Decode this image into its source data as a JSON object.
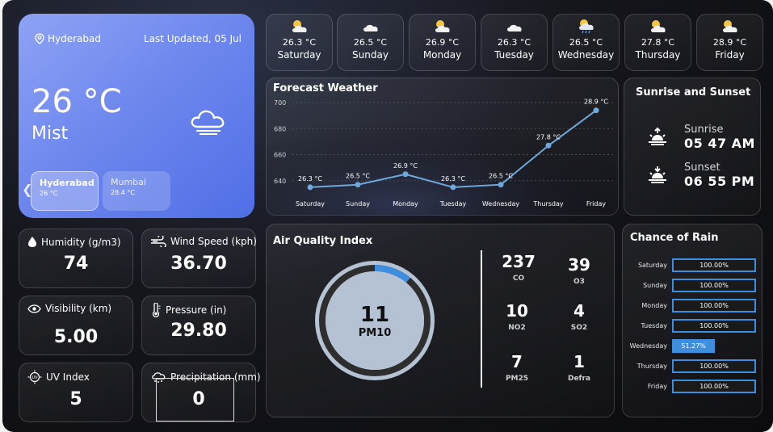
{
  "current": {
    "location": "Hyderabad",
    "last_updated": "Last Updated, 05 Jul",
    "temperature": "26 °C",
    "condition": "Mist",
    "cities": [
      {
        "name": "Hyderabad",
        "temp": "26 °C"
      },
      {
        "name": "Mumbai",
        "temp": "28.4 °C"
      }
    ]
  },
  "daily": [
    {
      "temp": "26.3 °C",
      "day": "Saturday",
      "icon": "sun-cloud-icon"
    },
    {
      "temp": "26.5 °C",
      "day": "Sunday",
      "icon": "cloud-icon"
    },
    {
      "temp": "26.9 °C",
      "day": "Monday",
      "icon": "sun-cloud-icon"
    },
    {
      "temp": "26.3 °C",
      "day": "Tuesday",
      "icon": "cloud-icon"
    },
    {
      "temp": "26.5 °C",
      "day": "Wednesday",
      "icon": "sun-cloud-rain-icon"
    },
    {
      "temp": "27.8 °C",
      "day": "Thursday",
      "icon": "sun-cloud-icon"
    },
    {
      "temp": "28.9 °C",
      "day": "Friday",
      "icon": "sun-cloud-icon"
    }
  ],
  "forecast": {
    "title": "Forecast Weather"
  },
  "chart_data": {
    "type": "line",
    "categories": [
      "Saturday",
      "Sunday",
      "Monday",
      "Tuesday",
      "Wednesday",
      "Thursday",
      "Friday"
    ],
    "series": [
      {
        "values": [
          635,
          637,
          645,
          635,
          637,
          667,
          694
        ]
      }
    ],
    "data_labels": [
      "26.3 °C",
      "26.5 °C",
      "26.9 °C",
      "26.3 °C",
      "26.5 °C",
      "27.8 °C",
      "28.9 °C"
    ],
    "yticks": [
      640,
      660,
      680,
      700
    ],
    "ylim": [
      630,
      700
    ],
    "grid": true,
    "color": "#6fa8dc"
  },
  "sun": {
    "title": "Sunrise and Sunset",
    "sunrise_label": "Sunrise",
    "sunrise_time": "05 47 AM",
    "sunset_label": "Sunset",
    "sunset_time": "06 55 PM"
  },
  "stats": {
    "humidity": {
      "label": "Humidity (g/m3)",
      "value": "74"
    },
    "wind": {
      "label": "Wind Speed (kph)",
      "value": "36.70"
    },
    "visibility": {
      "label": "Visibility (km)",
      "value": "5.00"
    },
    "pressure": {
      "label": "Pressure (in)",
      "value": "29.80"
    },
    "uv": {
      "label": "UV Index",
      "value": "5"
    },
    "precip": {
      "label": "Precipitation (mm)",
      "value": "0"
    }
  },
  "aqi": {
    "title": "Air Quality Index",
    "main_value": "11",
    "main_label": "PM10",
    "gauge_fraction": 0.11,
    "pollutants": [
      {
        "value": "237",
        "name": "CO"
      },
      {
        "value": "39",
        "name": "O3"
      },
      {
        "value": "10",
        "name": "NO2"
      },
      {
        "value": "4",
        "name": "SO2"
      },
      {
        "value": "7",
        "name": "PM25"
      },
      {
        "value": "1",
        "name": "Defra"
      }
    ]
  },
  "rain": {
    "title": "Chance of Rain",
    "rows": [
      {
        "day": "Saturday",
        "pct": 100,
        "label": "100.00%"
      },
      {
        "day": "Sunday",
        "pct": 100,
        "label": "100.00%"
      },
      {
        "day": "Monday",
        "pct": 100,
        "label": "100.00%"
      },
      {
        "day": "Tuesday",
        "pct": 100,
        "label": "100.00%"
      },
      {
        "day": "Wednesday",
        "pct": 51.27,
        "label": "51.27%"
      },
      {
        "day": "Thursday",
        "pct": 100,
        "label": "100.00%"
      },
      {
        "day": "Friday",
        "pct": 100,
        "label": "100.00%"
      }
    ]
  },
  "colors": {
    "accent": "#3e8ee0",
    "main_card": "#6f88ee",
    "gauge": "#b4c2d3"
  }
}
